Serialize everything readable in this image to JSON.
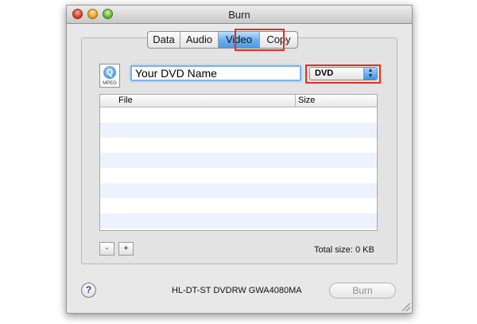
{
  "window": {
    "title": "Burn"
  },
  "tabs": [
    {
      "label": "Data"
    },
    {
      "label": "Audio"
    },
    {
      "label": "Video"
    },
    {
      "label": "Copy"
    }
  ],
  "active_tab": "Video",
  "file_icon": {
    "label": "MPEG",
    "icon": "mpeg-file-icon"
  },
  "name_field": {
    "value": "Your DVD Name"
  },
  "format_select": {
    "value": "DVD"
  },
  "table": {
    "columns": [
      "File",
      "Size"
    ],
    "rows": []
  },
  "buttons": {
    "remove": "-",
    "add": "+",
    "help": "?",
    "burn": "Burn"
  },
  "total_size": "Total size: 0 KB",
  "drive_name": "HL-DT-ST DVDRW GWA4080MA",
  "colors": {
    "highlight": "#e0301f",
    "active_tab": "#4d9ae8",
    "row_stripe": "#edf3fe"
  }
}
